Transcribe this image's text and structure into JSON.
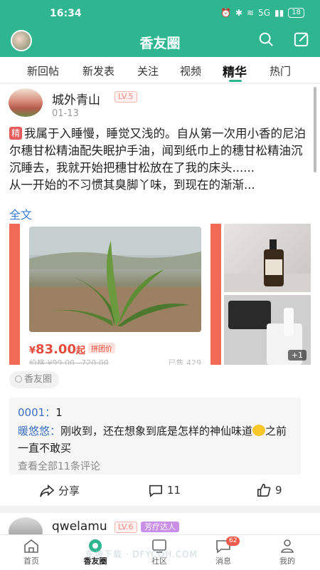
{
  "status_bar": {
    "time": "16:34",
    "battery": "18",
    "network": "5G"
  },
  "header": {
    "title": "香友圈"
  },
  "tabs": [
    {
      "label": "新回帖"
    },
    {
      "label": "新发表"
    },
    {
      "label": "关注"
    },
    {
      "label": "视频"
    },
    {
      "label": "精华",
      "active": true
    },
    {
      "label": "热门"
    }
  ],
  "post": {
    "username": "城外青山",
    "level": "LV.5",
    "date": "01-13",
    "essence_tag": "精",
    "text": "我属于入睡慢，睡觉又浅的。自从第一次用小香的尼泊尔穗甘松精油配失眠护手油，闻到纸巾上的穗甘松精油沉沉睡去，我就开始把穗甘松放在了我的床头......",
    "text2": "从一开始的不习惯其臭脚丫味，到现在的渐渐...",
    "full_text_label": "全文",
    "product": {
      "price_symbol": "¥",
      "price": "83.00",
      "price_suffix": "起",
      "group_tag": "拼团价",
      "orig_price": "价格 ¥99.00~720.00",
      "sold": "已售 429"
    },
    "more_images": "+1",
    "topic": "香友圈",
    "comments": [
      {
        "name": "0001：",
        "text": "1"
      },
      {
        "name": "暖悠悠：",
        "text": "刚收到，还在想象到底是怎样的神仙味道",
        "text_after": "之前一直不敢买"
      }
    ],
    "view_all_comments": "查看全部11条评论",
    "actions": {
      "share": "分享",
      "comments": "11",
      "likes": "9"
    }
  },
  "next_post": {
    "username": "qwelamu",
    "level": "LV.6",
    "badge": "芳疗达人"
  },
  "bottom_nav": [
    {
      "label": "首页"
    },
    {
      "label": "香友圈",
      "active": true
    },
    {
      "label": "社区"
    },
    {
      "label": "消息",
      "badge": "62"
    },
    {
      "label": "我的"
    }
  ],
  "watermark": "东坡下载 · DFYCQH.COM",
  "colors": {
    "brand": "#2fb58f",
    "link": "#3a7bd5",
    "price": "#e84b3c"
  }
}
